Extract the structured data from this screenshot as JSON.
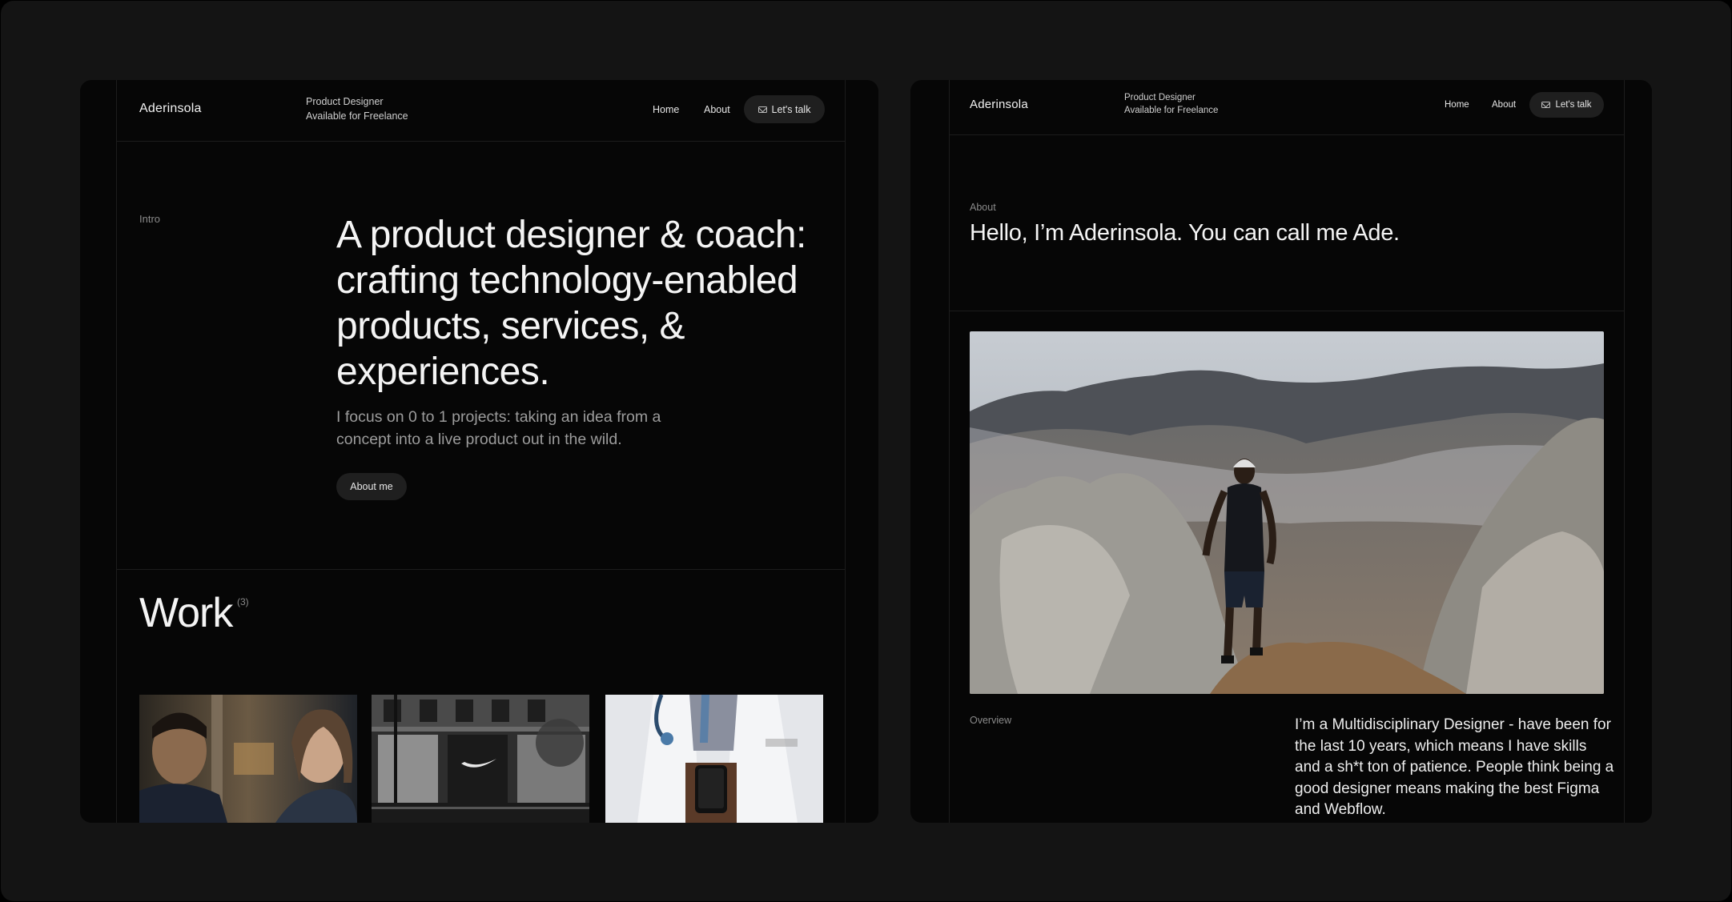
{
  "left_page": {
    "header": {
      "logo": "Aderinsola",
      "tagline_line1": "Product Designer",
      "tagline_line2": "Available for Freelance",
      "nav": {
        "home": "Home",
        "about": "About",
        "cta": "Let's talk"
      }
    },
    "intro": {
      "label": "Intro",
      "headline": "A product designer & coach: crafting technology-enabled products, services, & experiences.",
      "subtext": "I focus on 0 to 1 projects: taking an idea from a concept into a live product out in the wild.",
      "button": "About me"
    },
    "work": {
      "title": "Work",
      "count": "(3)",
      "thumbnails": [
        {
          "icon": "two-people-photo"
        },
        {
          "icon": "storefront-photo"
        },
        {
          "icon": "doctor-phone-photo"
        }
      ]
    }
  },
  "right_page": {
    "header": {
      "logo": "Aderinsola",
      "tagline_line1": "Product Designer",
      "tagline_line2": "Available for Freelance",
      "nav": {
        "home": "Home",
        "about": "About",
        "cta": "Let's talk"
      }
    },
    "about": {
      "label": "About",
      "heading": "Hello, I’m Aderinsola. You can call me Ade.",
      "photo_icon": "hiker-on-volcano-photo"
    },
    "overview": {
      "label": "Overview",
      "text": "I’m a Multidisciplinary Designer - have been for the last 10 years, which means I have skills and a sh*t ton of patience. People think being a good designer means making the best Figma and Webflow."
    }
  },
  "colors": {
    "background": "#141414",
    "panel": "#060606",
    "pill": "#1f1f1f",
    "text_primary": "#f4f4f4",
    "text_muted": "#8a8a8a"
  }
}
